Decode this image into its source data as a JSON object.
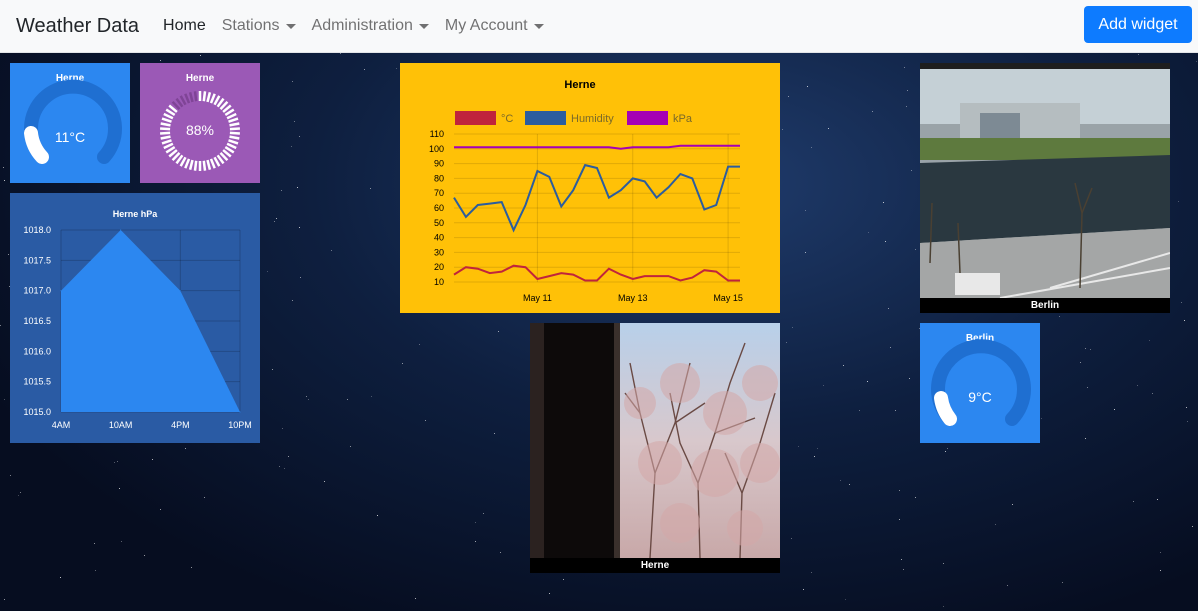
{
  "navbar": {
    "brand": "Weather Data",
    "items": [
      {
        "label": "Home"
      },
      {
        "label": "Stations"
      },
      {
        "label": "Administration"
      },
      {
        "label": "My Account"
      }
    ],
    "add_widget": "Add widget"
  },
  "widgets": {
    "herne_temp": {
      "title": "Herne",
      "value": "11°C"
    },
    "herne_humidity": {
      "title": "Herne",
      "value": "88%"
    },
    "berlin_temp": {
      "title": "Berlin",
      "value": "9°C"
    },
    "berlin_cam": {
      "caption": "Berlin"
    },
    "herne_cam": {
      "caption": "Herne"
    }
  },
  "chart_data": [
    {
      "type": "area",
      "title": "Herne hPa",
      "categories": [
        "4AM",
        "10AM",
        "4PM",
        "10PM"
      ],
      "values": [
        1017.0,
        1018.0,
        1017.0,
        1015.0
      ],
      "ylim": [
        1015.0,
        1018.0
      ],
      "yticks": [
        "1018.0",
        "1017.5",
        "1017.0",
        "1016.5",
        "1016.0",
        "1015.5",
        "1015.0"
      ],
      "color": "#2c87f0"
    },
    {
      "type": "line",
      "title": "Herne",
      "xticks": [
        "May 11",
        "May 13",
        "May 15"
      ],
      "ylim": [
        10,
        110
      ],
      "yticks": [
        "110",
        "100",
        "90",
        "80",
        "70",
        "60",
        "50",
        "40",
        "30",
        "20",
        "10"
      ],
      "series": [
        {
          "name": "°C",
          "color": "#c0243c",
          "values": [
            15,
            20,
            19,
            16,
            17,
            21,
            20,
            12,
            14,
            16,
            15,
            11,
            11,
            19,
            15,
            12,
            14,
            14,
            14,
            11,
            13,
            18,
            17,
            11,
            11
          ]
        },
        {
          "name": "Humidity",
          "color": "#2c5d9e",
          "values": [
            67,
            54,
            62,
            63,
            64,
            45,
            62,
            85,
            81,
            61,
            72,
            89,
            87,
            67,
            72,
            80,
            78,
            67,
            74,
            83,
            80,
            59,
            62,
            88,
            88
          ]
        },
        {
          "name": "kPa",
          "color": "#a500b5",
          "values": [
            101,
            101,
            101,
            101,
            101,
            101,
            101,
            101,
            101,
            101,
            101,
            101,
            101,
            101,
            100,
            101,
            101,
            101,
            101,
            102,
            102,
            102,
            102,
            102,
            102
          ]
        }
      ]
    }
  ]
}
